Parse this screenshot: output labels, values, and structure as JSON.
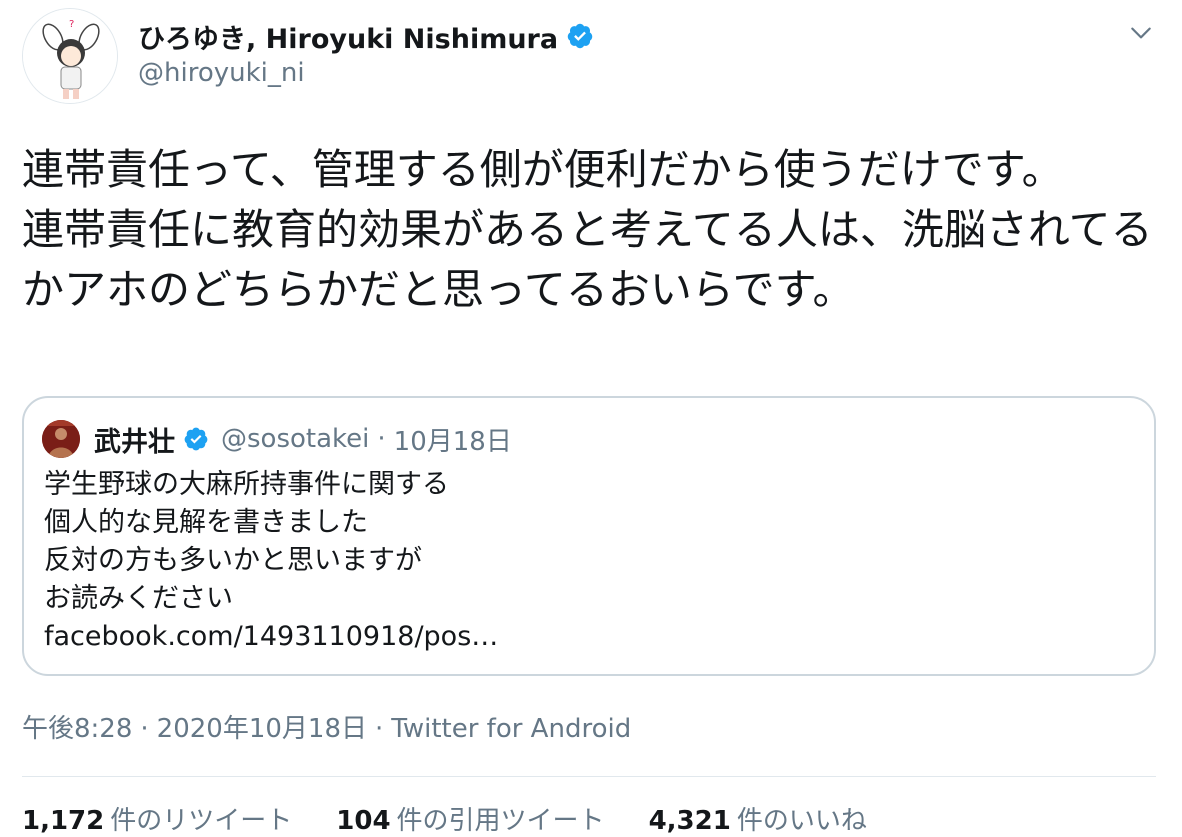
{
  "author": {
    "display_name": "ひろゆき, Hiroyuki Nishimura",
    "handle": "@hiroyuki_ni",
    "verified": true
  },
  "tweet": {
    "text": "連帯責任って、管理する側が便利だから使うだけです。\n連帯責任に教育的効果があると考えてる人は、洗脳されてるかアホのどちらかだと思ってるおいらです。"
  },
  "quoted_tweet": {
    "display_name": "武井壮",
    "handle": "@sosotakei",
    "separator": "·",
    "date": "10月18日",
    "lines": [
      "学生野球の大麻所持事件に関する",
      "個人的な見解を書きました",
      "反対の方も多いかと思いますが",
      "お読みください",
      "facebook.com/1493110918/pos…"
    ]
  },
  "meta": {
    "time": "午後8:28",
    "date": "2020年10月18日",
    "source": "Twitter for Android",
    "sep1": "·",
    "sep2": "·"
  },
  "stats": {
    "retweets": "1,172",
    "retweets_label": "件のリツイート",
    "quotes": "104",
    "quotes_label": "件の引用ツイート",
    "likes": "4,321",
    "likes_label": "件のいいね"
  },
  "colors": {
    "accent": "#1da1f2",
    "text": "#14171a",
    "secondary": "#657786",
    "border": "#ccd6dd"
  },
  "icons": {
    "verified": "verified-badge-icon",
    "menu": "chevron-down-icon"
  }
}
